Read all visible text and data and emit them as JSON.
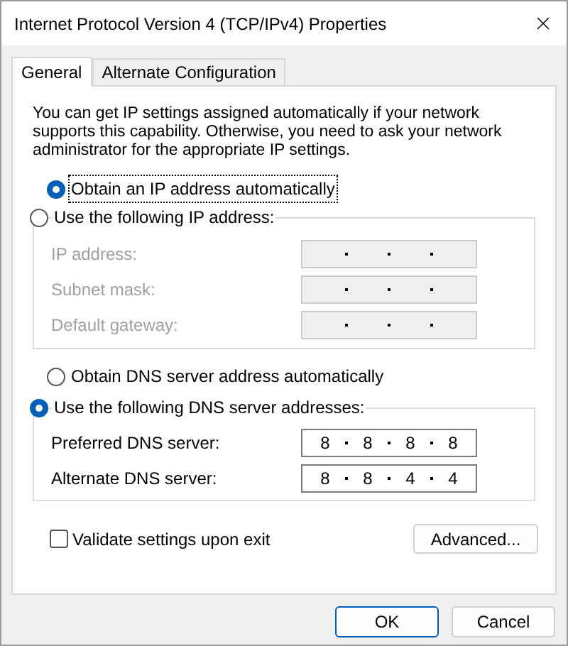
{
  "window": {
    "title": "Internet Protocol Version 4 (TCP/IPv4) Properties"
  },
  "tabs": [
    {
      "label": "General",
      "selected": true
    },
    {
      "label": "Alternate Configuration",
      "selected": false
    }
  ],
  "description": "You can get IP settings assigned automatically if your network supports this capability. Otherwise, you need to ask your network administrator for the appropriate IP settings.",
  "ip_section": {
    "options": [
      {
        "label": "Obtain an IP address automatically",
        "selected": true
      },
      {
        "label": "Use the following IP address:",
        "selected": false
      }
    ],
    "fields": [
      {
        "label": "IP address:",
        "disabled": true
      },
      {
        "label": "Subnet mask:",
        "disabled": true
      },
      {
        "label": "Default gateway:",
        "disabled": true
      }
    ]
  },
  "dns_section": {
    "options": [
      {
        "label": "Obtain DNS server address automatically",
        "selected": false
      },
      {
        "label": "Use the following DNS server addresses:",
        "selected": true
      }
    ],
    "fields": [
      {
        "label": "Preferred DNS server:",
        "disabled": false,
        "octets": [
          "8",
          "8",
          "8",
          "8"
        ]
      },
      {
        "label": "Alternate DNS server:",
        "disabled": false,
        "octets": [
          "8",
          "8",
          "4",
          "4"
        ]
      }
    ]
  },
  "validate": {
    "label": "Validate settings upon exit",
    "checked": false
  },
  "advanced_button": "Advanced...",
  "buttons": [
    {
      "label": "OK",
      "default": true
    },
    {
      "label": "Cancel",
      "default": false
    }
  ]
}
